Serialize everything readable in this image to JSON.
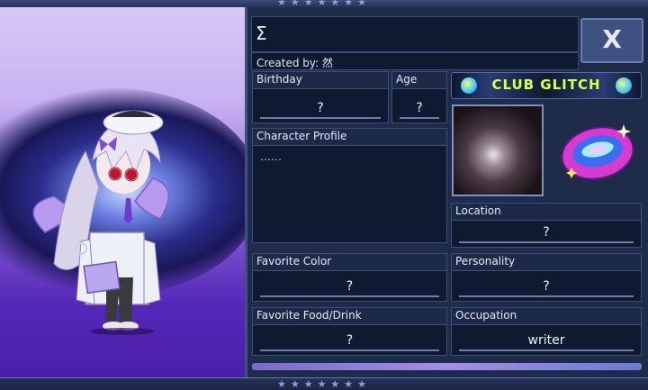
{
  "profile": {
    "title": "Σ",
    "created_by": "Created by: 然",
    "close_label": "X",
    "club_name": "CLUB GLITCH",
    "fields": {
      "birthday": {
        "label": "Birthday",
        "value": "?"
      },
      "age": {
        "label": "Age",
        "value": "?"
      },
      "character_profile": {
        "label": "Character Profile",
        "value": "……"
      },
      "location": {
        "label": "Location",
        "value": "?"
      },
      "favorite_color": {
        "label": "Favorite Color",
        "value": "?"
      },
      "personality": {
        "label": "Personality",
        "value": "?"
      },
      "favorite_food": {
        "label": "Favorite Food/Drink",
        "value": "?"
      },
      "occupation": {
        "label": "Occupation",
        "value": "writer"
      }
    }
  },
  "colors": {
    "panel_bg": "#1f2c49",
    "field_bg": "#0f1a30",
    "accent_club": "#d9ff5a",
    "scene_top": "#d9c8f6",
    "scene_bottom": "#4a1fa8"
  },
  "icons": [
    "star-icon",
    "close-icon",
    "club-logo-icon",
    "club-emblem-icon"
  ]
}
